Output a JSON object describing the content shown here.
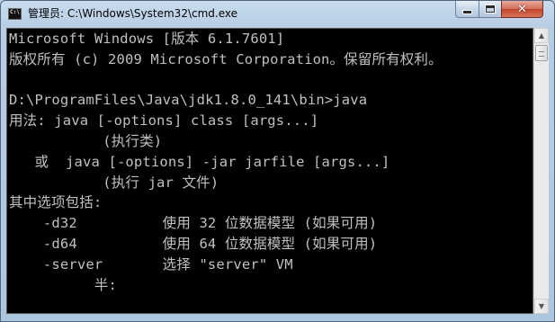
{
  "window": {
    "title": "管理员: C:\\Windows\\System32\\cmd.exe",
    "icon": "cmd-icon",
    "icon_text": "C:\\",
    "controls": {
      "minimize": "minimize-icon",
      "maximize": "maximize-icon",
      "close": "close-icon"
    }
  },
  "console": {
    "background": "#000000",
    "foreground": "#c0c0c0",
    "lines": [
      "Microsoft Windows [版本 6.1.7601]",
      "版权所有 (c) 2009 Microsoft Corporation。保留所有权利。",
      "",
      "D:\\ProgramFiles\\Java\\jdk1.8.0_141\\bin>java",
      "用法: java [-options] class [args...]",
      "           (执行类)",
      "   或  java [-options] -jar jarfile [args...]",
      "           (执行 jar 文件)",
      "其中选项包括:",
      "    -d32          使用 32 位数据模型 (如果可用)",
      "    -d64          使用 64 位数据模型 (如果可用)",
      "    -server       选择 \"server\" VM",
      "          半:"
    ]
  },
  "scrollbar": {
    "up_icon": "scroll-up-arrow-icon",
    "down_icon": "scroll-down-arrow-icon",
    "up_glyph": "▲",
    "down_glyph": "▼",
    "position": 0.0
  }
}
